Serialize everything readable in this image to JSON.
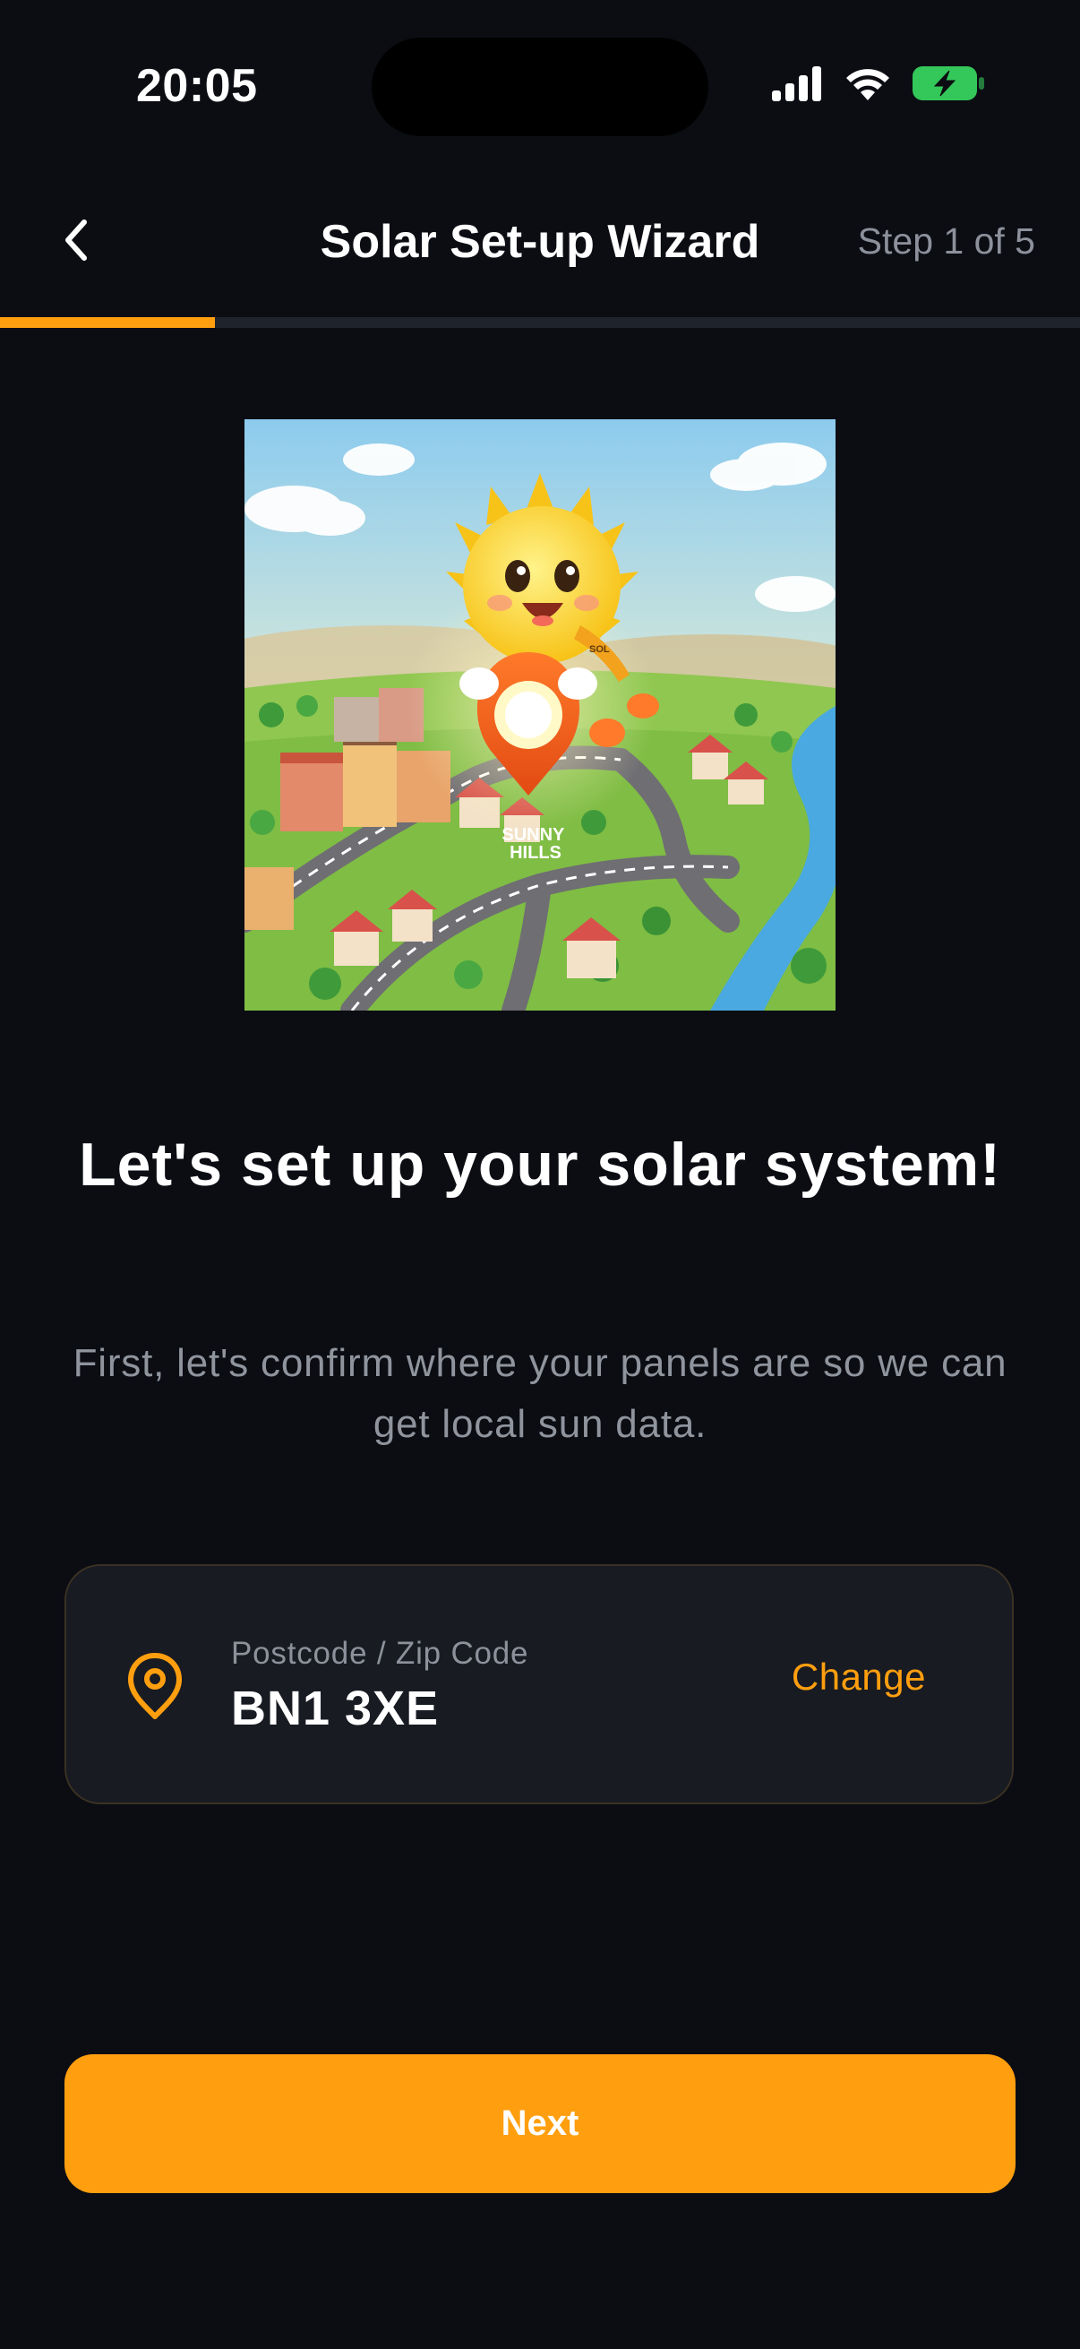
{
  "status_bar": {
    "time": "20:05",
    "signal_icon": "cellular-signal-icon",
    "wifi_icon": "wifi-icon",
    "battery_icon": "battery-charging-icon",
    "battery_color": "#34c759"
  },
  "nav": {
    "back_icon": "chevron-left-icon",
    "title": "Solar Set-up Wizard",
    "step_label": "Step 1 of 5"
  },
  "progress": {
    "current_step": 1,
    "total_steps": 5,
    "fraction": 0.2
  },
  "hero": {
    "image": "sun-mascot-town-illustration",
    "sign_text": "SUNNY\nHILLS",
    "sash_text": "SOL"
  },
  "headline": "Let's set up your solar system!",
  "subtext": "First, let's confirm where your panels are so we can get local sun data.",
  "location": {
    "icon": "location-pin-icon",
    "label": "Postcode / Zip Code",
    "value": "BN1 3XE",
    "change_label": "Change"
  },
  "next_button_label": "Next",
  "colors": {
    "background": "#0b0d13",
    "accent": "#ff9f0f",
    "card": "#181b22",
    "muted_text": "#8d919b"
  }
}
